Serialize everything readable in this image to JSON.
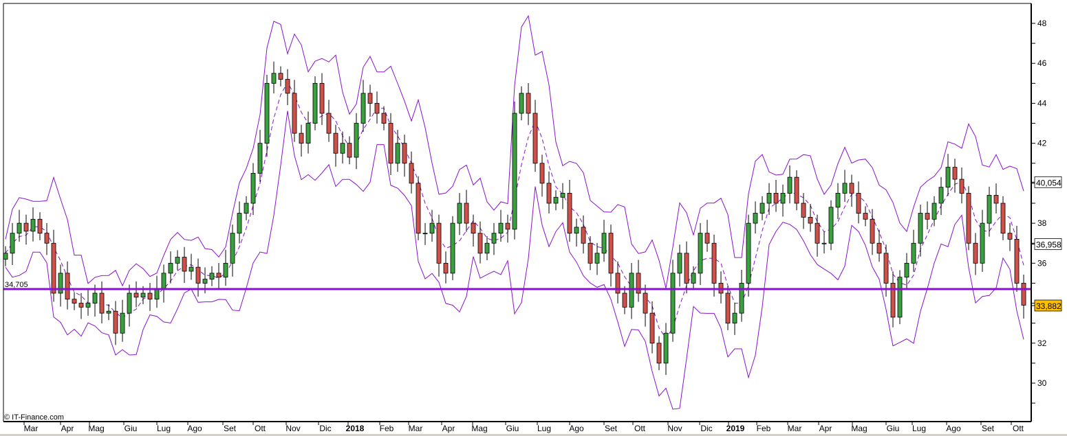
{
  "chart_data": {
    "type": "candlestick",
    "title": "",
    "credit": "© IT-Finance.com",
    "x_unit": "week index",
    "closes": [
      36.5,
      37.5,
      38,
      37.6,
      38.2,
      37.5,
      37,
      34.5,
      35.5,
      34.2,
      34,
      33.8,
      34,
      34.5,
      33.5,
      33.6,
      32.5,
      33.5,
      34.5,
      34.3,
      34.5,
      34.2,
      34.7,
      35.5,
      36,
      36.3,
      35.6,
      35.8,
      35,
      35.2,
      35.5,
      35.3,
      36,
      37.5,
      38.5,
      39,
      40.5,
      42,
      45,
      45.5,
      45.2,
      44.5,
      42.5,
      42,
      43,
      45,
      43.5,
      42.5,
      41.5,
      42,
      41.3,
      43,
      44.5,
      44,
      43.5,
      43,
      41,
      42,
      41,
      40,
      37.5,
      37.5,
      38,
      36,
      35.5,
      38,
      39,
      38,
      37.5,
      36.5,
      37,
      37.5,
      38,
      37.7,
      43.5,
      44.5,
      43.5,
      41,
      40,
      39,
      39.3,
      39.5,
      37.5,
      37.8,
      37,
      36,
      36.5,
      37.5,
      35.5,
      34.5,
      33.8,
      35.5,
      34.5,
      33.5,
      32,
      31,
      32.5,
      35.5,
      36.5,
      35,
      35.5,
      37.5,
      37,
      35,
      34.5,
      33,
      33.5,
      35,
      38,
      38.5,
      39,
      39.5,
      39,
      39.5,
      40.3,
      39,
      38.3,
      38,
      37,
      37,
      38.8,
      39.5,
      40,
      39.5,
      38.5,
      38.2,
      37,
      36.5,
      35,
      33.3,
      35.3,
      36,
      37,
      38.5,
      38.2,
      39,
      39.8,
      40.8,
      40.2,
      39.5,
      37,
      36,
      38,
      39.4,
      39,
      37.5,
      37.2,
      35,
      33.9
    ],
    "bollinger": {
      "period": 4,
      "std_dev": 2
    },
    "y_axis": {
      "ylim": [
        28.5,
        49
      ],
      "ticks": [
        30,
        32,
        34,
        36,
        38,
        40,
        42,
        44,
        46,
        48
      ]
    },
    "x_axis": {
      "labels": [
        {
          "label": "Mar",
          "index": 3.7
        },
        {
          "label": "Apr",
          "index": 9
        },
        {
          "label": "Mag",
          "index": 13.2
        },
        {
          "label": "Giu",
          "index": 18.2
        },
        {
          "label": "Lug",
          "index": 23
        },
        {
          "label": "Ago",
          "index": 27.5
        },
        {
          "label": "Set",
          "index": 32.6
        },
        {
          "label": "Ott",
          "index": 37
        },
        {
          "label": "Nov",
          "index": 41.8
        },
        {
          "label": "Dic",
          "index": 46.5
        },
        {
          "label": "2018",
          "index": 50.8,
          "bold": true
        },
        {
          "label": "Feb",
          "index": 55.4
        },
        {
          "label": "Mar",
          "index": 59.6
        },
        {
          "label": "Apr",
          "index": 64.4
        },
        {
          "label": "Mag",
          "index": 68.9
        },
        {
          "label": "Giu",
          "index": 73.7
        },
        {
          "label": "Lug",
          "index": 78.3
        },
        {
          "label": "Ago",
          "index": 83
        },
        {
          "label": "Set",
          "index": 88
        },
        {
          "label": "Ott",
          "index": 92.2
        },
        {
          "label": "Nov",
          "index": 97.3
        },
        {
          "label": "Dic",
          "index": 101.9
        },
        {
          "label": "2019",
          "index": 106.1,
          "bold": true
        },
        {
          "label": "Feb",
          "index": 110.2
        },
        {
          "label": "Mar",
          "index": 114.7
        },
        {
          "label": "Apr",
          "index": 119.2
        },
        {
          "label": "Mag",
          "index": 124.1
        },
        {
          "label": "Giu",
          "index": 129
        },
        {
          "label": "Lug",
          "index": 132.8
        },
        {
          "label": "Ago",
          "index": 137.8
        },
        {
          "label": "Set",
          "index": 142.8
        },
        {
          "label": "Ott",
          "index": 147.2
        }
      ]
    },
    "horizontal_line": {
      "value": 34.705,
      "label": "34,705"
    },
    "value_labels": [
      {
        "value": 40.054,
        "label": "40,054",
        "kind": "upper-band"
      },
      {
        "value": 36.958,
        "label": "36,958",
        "kind": "middle-band"
      },
      {
        "value": 33.882,
        "label": "33,882",
        "kind": "last-price"
      }
    ],
    "colors": {
      "up": "#3aa040",
      "down": "#d0504a",
      "band": "#8a10d0",
      "hline": "#8a10d0",
      "last_bg": "#ffc000"
    }
  }
}
